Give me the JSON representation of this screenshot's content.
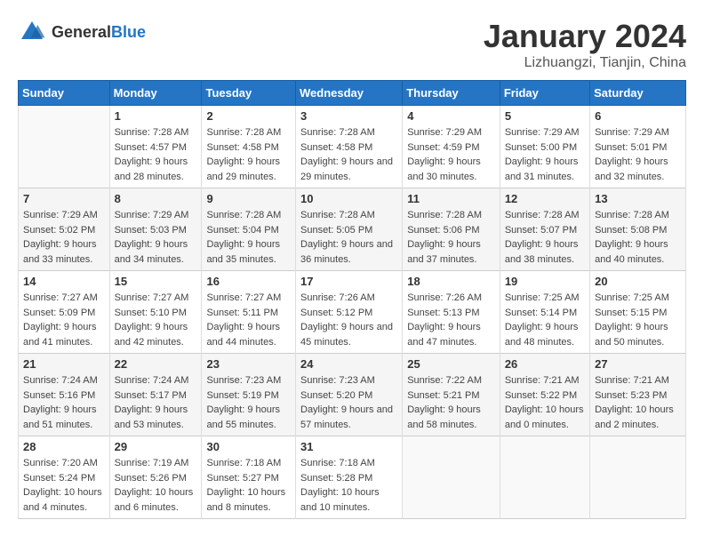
{
  "header": {
    "logo_general": "General",
    "logo_blue": "Blue",
    "title": "January 2024",
    "subtitle": "Lizhuangzi, Tianjin, China"
  },
  "days_of_week": [
    "Sunday",
    "Monday",
    "Tuesday",
    "Wednesday",
    "Thursday",
    "Friday",
    "Saturday"
  ],
  "weeks": [
    {
      "cells": [
        {
          "day": "",
          "empty": true
        },
        {
          "day": "1",
          "sunrise": "7:28 AM",
          "sunset": "4:57 PM",
          "daylight": "9 hours and 28 minutes."
        },
        {
          "day": "2",
          "sunrise": "7:28 AM",
          "sunset": "4:58 PM",
          "daylight": "9 hours and 29 minutes."
        },
        {
          "day": "3",
          "sunrise": "7:28 AM",
          "sunset": "4:58 PM",
          "daylight": "9 hours and 29 minutes."
        },
        {
          "day": "4",
          "sunrise": "7:29 AM",
          "sunset": "4:59 PM",
          "daylight": "9 hours and 30 minutes."
        },
        {
          "day": "5",
          "sunrise": "7:29 AM",
          "sunset": "5:00 PM",
          "daylight": "9 hours and 31 minutes."
        },
        {
          "day": "6",
          "sunrise": "7:29 AM",
          "sunset": "5:01 PM",
          "daylight": "9 hours and 32 minutes."
        }
      ]
    },
    {
      "cells": [
        {
          "day": "7",
          "sunrise": "7:29 AM",
          "sunset": "5:02 PM",
          "daylight": "9 hours and 33 minutes."
        },
        {
          "day": "8",
          "sunrise": "7:29 AM",
          "sunset": "5:03 PM",
          "daylight": "9 hours and 34 minutes."
        },
        {
          "day": "9",
          "sunrise": "7:28 AM",
          "sunset": "5:04 PM",
          "daylight": "9 hours and 35 minutes."
        },
        {
          "day": "10",
          "sunrise": "7:28 AM",
          "sunset": "5:05 PM",
          "daylight": "9 hours and 36 minutes."
        },
        {
          "day": "11",
          "sunrise": "7:28 AM",
          "sunset": "5:06 PM",
          "daylight": "9 hours and 37 minutes."
        },
        {
          "day": "12",
          "sunrise": "7:28 AM",
          "sunset": "5:07 PM",
          "daylight": "9 hours and 38 minutes."
        },
        {
          "day": "13",
          "sunrise": "7:28 AM",
          "sunset": "5:08 PM",
          "daylight": "9 hours and 40 minutes."
        }
      ]
    },
    {
      "cells": [
        {
          "day": "14",
          "sunrise": "7:27 AM",
          "sunset": "5:09 PM",
          "daylight": "9 hours and 41 minutes."
        },
        {
          "day": "15",
          "sunrise": "7:27 AM",
          "sunset": "5:10 PM",
          "daylight": "9 hours and 42 minutes."
        },
        {
          "day": "16",
          "sunrise": "7:27 AM",
          "sunset": "5:11 PM",
          "daylight": "9 hours and 44 minutes."
        },
        {
          "day": "17",
          "sunrise": "7:26 AM",
          "sunset": "5:12 PM",
          "daylight": "9 hours and 45 minutes."
        },
        {
          "day": "18",
          "sunrise": "7:26 AM",
          "sunset": "5:13 PM",
          "daylight": "9 hours and 47 minutes."
        },
        {
          "day": "19",
          "sunrise": "7:25 AM",
          "sunset": "5:14 PM",
          "daylight": "9 hours and 48 minutes."
        },
        {
          "day": "20",
          "sunrise": "7:25 AM",
          "sunset": "5:15 PM",
          "daylight": "9 hours and 50 minutes."
        }
      ]
    },
    {
      "cells": [
        {
          "day": "21",
          "sunrise": "7:24 AM",
          "sunset": "5:16 PM",
          "daylight": "9 hours and 51 minutes."
        },
        {
          "day": "22",
          "sunrise": "7:24 AM",
          "sunset": "5:17 PM",
          "daylight": "9 hours and 53 minutes."
        },
        {
          "day": "23",
          "sunrise": "7:23 AM",
          "sunset": "5:19 PM",
          "daylight": "9 hours and 55 minutes."
        },
        {
          "day": "24",
          "sunrise": "7:23 AM",
          "sunset": "5:20 PM",
          "daylight": "9 hours and 57 minutes."
        },
        {
          "day": "25",
          "sunrise": "7:22 AM",
          "sunset": "5:21 PM",
          "daylight": "9 hours and 58 minutes."
        },
        {
          "day": "26",
          "sunrise": "7:21 AM",
          "sunset": "5:22 PM",
          "daylight": "10 hours and 0 minutes."
        },
        {
          "day": "27",
          "sunrise": "7:21 AM",
          "sunset": "5:23 PM",
          "daylight": "10 hours and 2 minutes."
        }
      ]
    },
    {
      "cells": [
        {
          "day": "28",
          "sunrise": "7:20 AM",
          "sunset": "5:24 PM",
          "daylight": "10 hours and 4 minutes."
        },
        {
          "day": "29",
          "sunrise": "7:19 AM",
          "sunset": "5:26 PM",
          "daylight": "10 hours and 6 minutes."
        },
        {
          "day": "30",
          "sunrise": "7:18 AM",
          "sunset": "5:27 PM",
          "daylight": "10 hours and 8 minutes."
        },
        {
          "day": "31",
          "sunrise": "7:18 AM",
          "sunset": "5:28 PM",
          "daylight": "10 hours and 10 minutes."
        },
        {
          "day": "",
          "empty": true
        },
        {
          "day": "",
          "empty": true
        },
        {
          "day": "",
          "empty": true
        }
      ]
    }
  ],
  "labels": {
    "sunrise": "Sunrise:",
    "sunset": "Sunset:",
    "daylight": "Daylight:"
  }
}
